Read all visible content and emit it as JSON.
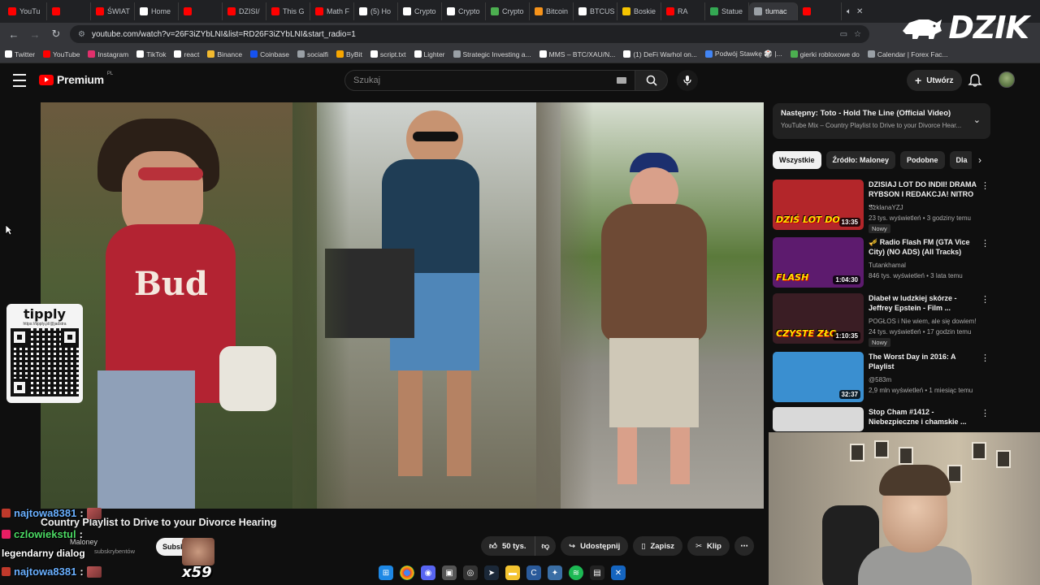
{
  "browser": {
    "tabs": [
      {
        "label": "YouTu",
        "color": "#ff0000"
      },
      {
        "label": "",
        "color": "#ff0000"
      },
      {
        "label": "ŚWIAT",
        "color": "#ff0000"
      },
      {
        "label": "Home",
        "color": "#ffffff"
      },
      {
        "label": "",
        "color": "#ff0000"
      },
      {
        "label": "DZISI/",
        "color": "#ff0000"
      },
      {
        "label": "This G",
        "color": "#ff0000"
      },
      {
        "label": "Math F",
        "color": "#ff0000"
      },
      {
        "label": "(5) Ho",
        "color": "#ffffff"
      },
      {
        "label": "Crypto",
        "color": "#ffffff"
      },
      {
        "label": "Crypto",
        "color": "#ffffff"
      },
      {
        "label": "Crypto",
        "color": "#4caf50"
      },
      {
        "label": "Bitcoin",
        "color": "#f7931a"
      },
      {
        "label": "BTCUS",
        "color": "#ffffff"
      },
      {
        "label": "Boskie",
        "color": "#f5c400"
      },
      {
        "label": "RA",
        "color": "#ff0000"
      },
      {
        "label": "Statue",
        "color": "#34a853"
      },
      {
        "label": "tlumac",
        "color": "#9aa0a6"
      },
      {
        "label": "",
        "color": "#ff0000"
      }
    ],
    "active_tab_index": 17,
    "url": "youtube.com/watch?v=26F3iZYbLNI&list=RD26F3iZYbLNI&start_radio=1",
    "bookmarks": [
      {
        "label": "Twitter",
        "color": "#ffffff"
      },
      {
        "label": "YouTube",
        "color": "#ff0000"
      },
      {
        "label": "Instagram",
        "color": "#e1306c"
      },
      {
        "label": "TikTok",
        "color": "#ffffff"
      },
      {
        "label": "react",
        "color": "#ffffff"
      },
      {
        "label": "Binance",
        "color": "#f3ba2f"
      },
      {
        "label": "Coinbase",
        "color": "#1652f0"
      },
      {
        "label": "socialfi",
        "color": "#9aa0a6"
      },
      {
        "label": "ByBit",
        "color": "#f7a600"
      },
      {
        "label": "script.txt",
        "color": "#ffffff"
      },
      {
        "label": "Lighter",
        "color": "#ffffff"
      },
      {
        "label": "Strategic Investing a...",
        "color": "#9aa0a6"
      },
      {
        "label": "MMS – BTC/XAU/N...",
        "color": "#ffffff"
      },
      {
        "label": "(1) DeFi Warhol on...",
        "color": "#ffffff"
      },
      {
        "label": "Podwój Stawkę 🎲 |...",
        "color": "#4285f4"
      },
      {
        "label": "gierki robloxowe do",
        "color": "#4caf50"
      },
      {
        "label": "Calendar | Forex Fac...",
        "color": "#9aa0a6"
      }
    ]
  },
  "overlay_logo": {
    "text": "DZIK"
  },
  "youtube": {
    "logo_word": "Premium",
    "region": "PL",
    "search_placeholder": "Szukaj",
    "create_label": "Utwórz"
  },
  "video": {
    "title": "Country Playlist to Drive to your Divorce Hearing",
    "channel": "Maloney",
    "subscribers": "subskrybentów",
    "subscribe_label": "Subsk",
    "likes": "50 tys.",
    "share": "Udostępnij",
    "save": "Zapisz",
    "clip": "Klip"
  },
  "tippy": {
    "title": "tipply",
    "url": "https://tipply.pl/@jadstra"
  },
  "up_next": {
    "title": "Następny: Toto - Hold The Line (Official Video)",
    "subtitle": "YouTube Mix – Country Playlist to Drive to your Divorce Hear..."
  },
  "chips": [
    "Wszystkie",
    "Źródło: Maloney",
    "Podobne",
    "Dla"
  ],
  "recommendations": [
    {
      "title": "DZISIAJ LOT DO INDII! DRAMA RYBSON I REDAKCJA! NITRO ...",
      "channel": "SzklanaYZJ",
      "meta": "23 tys. wyświetleń • 3 godziny temu",
      "badge": "Nowy",
      "duration": "13:35",
      "caption": "DZIŚ LOT DO",
      "thumb_bg": "#b3262a"
    },
    {
      "title": "🎺 Radio Flash FM (GTA Vice City) (NO ADS) (All Tracks)",
      "channel": "Tutankhamal",
      "meta": "846 tys. wyświetleń • 3 lata temu",
      "badge": "",
      "duration": "1:04:30",
      "caption": "FLASH",
      "thumb_bg": "#5d1b6e"
    },
    {
      "title": "Diabeł w ludzkiej skórze - Jeffrey Epstein - Film ...",
      "channel": "POGŁOS i Nie wiem, ale się dowiem!",
      "meta": "24 tys. wyświetleń • 17 godzin temu",
      "badge": "Nowy",
      "duration": "1:10:35",
      "caption": "CZYSTE ZŁO",
      "thumb_bg": "#3a1d24"
    },
    {
      "title": "The Worst Day in 2016: A Playlist",
      "channel": "@583m",
      "meta": "2,9 mln wyświetleń • 1 miesiąc temu",
      "badge": "",
      "duration": "32:37",
      "caption": "",
      "thumb_bg": "#3a8fd0"
    },
    {
      "title": "Stop Cham #1412 - Niebezpieczne i chamskie ...",
      "channel": "",
      "meta": "",
      "badge": "",
      "duration": "",
      "caption": "",
      "thumb_bg": "#d9d9d9"
    }
  ],
  "chat": [
    {
      "user": "najtowa8381",
      "message": "",
      "color": "#6ab0ff"
    },
    {
      "user": "czlowiekstul",
      "message": "legendarny dialog",
      "color": "#4cd964"
    },
    {
      "user": "najtowa8381",
      "message": "",
      "color": "#6ab0ff"
    }
  ],
  "emote_counter": "x59"
}
